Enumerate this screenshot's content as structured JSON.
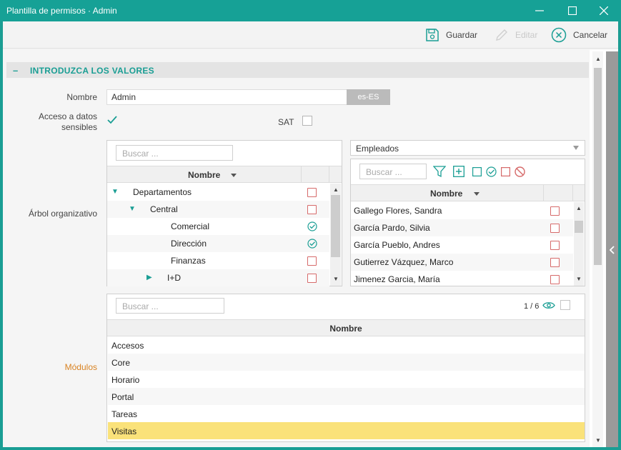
{
  "window": {
    "title": "Plantilla de permisos · Admin"
  },
  "toolbar": {
    "save_label": "Guardar",
    "edit_label": "Editar",
    "cancel_label": "Cancelar"
  },
  "section": {
    "toggle": "–",
    "title": "INTRODUZCA LOS VALORES"
  },
  "fields": {
    "name_label": "Nombre",
    "name_value": "Admin",
    "locale": "es-ES",
    "sensitive_label_1": "Acceso a datos",
    "sensitive_label_2": "sensibles",
    "sensitive_checked": true,
    "sat_label": "SAT",
    "sat_checked": false,
    "org_tree_label": "Árbol organizativo",
    "modules_label": "Módulos"
  },
  "org_tree": {
    "search_placeholder": "Buscar ...",
    "column_header": "Nombre",
    "rows": [
      {
        "label": "Departamentos",
        "expander": "▼",
        "state": "unchecked"
      },
      {
        "label": "Central",
        "expander": "▼",
        "state": "unchecked"
      },
      {
        "label": "Comercial",
        "expander": "",
        "state": "checked"
      },
      {
        "label": "Dirección",
        "expander": "",
        "state": "checked"
      },
      {
        "label": "Finanzas",
        "expander": "",
        "state": "unchecked"
      },
      {
        "label": "I+D",
        "expander": "▶",
        "state": "unchecked"
      }
    ]
  },
  "employees": {
    "dropdown_value": "Empleados",
    "search_placeholder": "Buscar ...",
    "column_header": "Nombre",
    "rows": [
      {
        "name": "Gallego Flores, Sandra"
      },
      {
        "name": "García Pardo, Silvia"
      },
      {
        "name": "García Pueblo, Andres"
      },
      {
        "name": "Gutierrez Vázquez, Marco"
      },
      {
        "name": "Jimenez Garcia, María"
      }
    ]
  },
  "modules": {
    "search_placeholder": "Buscar ...",
    "pager": "1 / 6",
    "column_header": "Nombre",
    "rows": [
      {
        "name": "Accesos",
        "selected": false
      },
      {
        "name": "Core",
        "selected": false
      },
      {
        "name": "Horario",
        "selected": false
      },
      {
        "name": "Portal",
        "selected": false
      },
      {
        "name": "Tareas",
        "selected": false
      },
      {
        "name": "Visitas",
        "selected": true
      }
    ]
  },
  "colors": {
    "accent": "#1a9e94",
    "checkbox_border": "#d66a6a",
    "selected_row": "#fae27a",
    "label_orange": "#d98323"
  }
}
